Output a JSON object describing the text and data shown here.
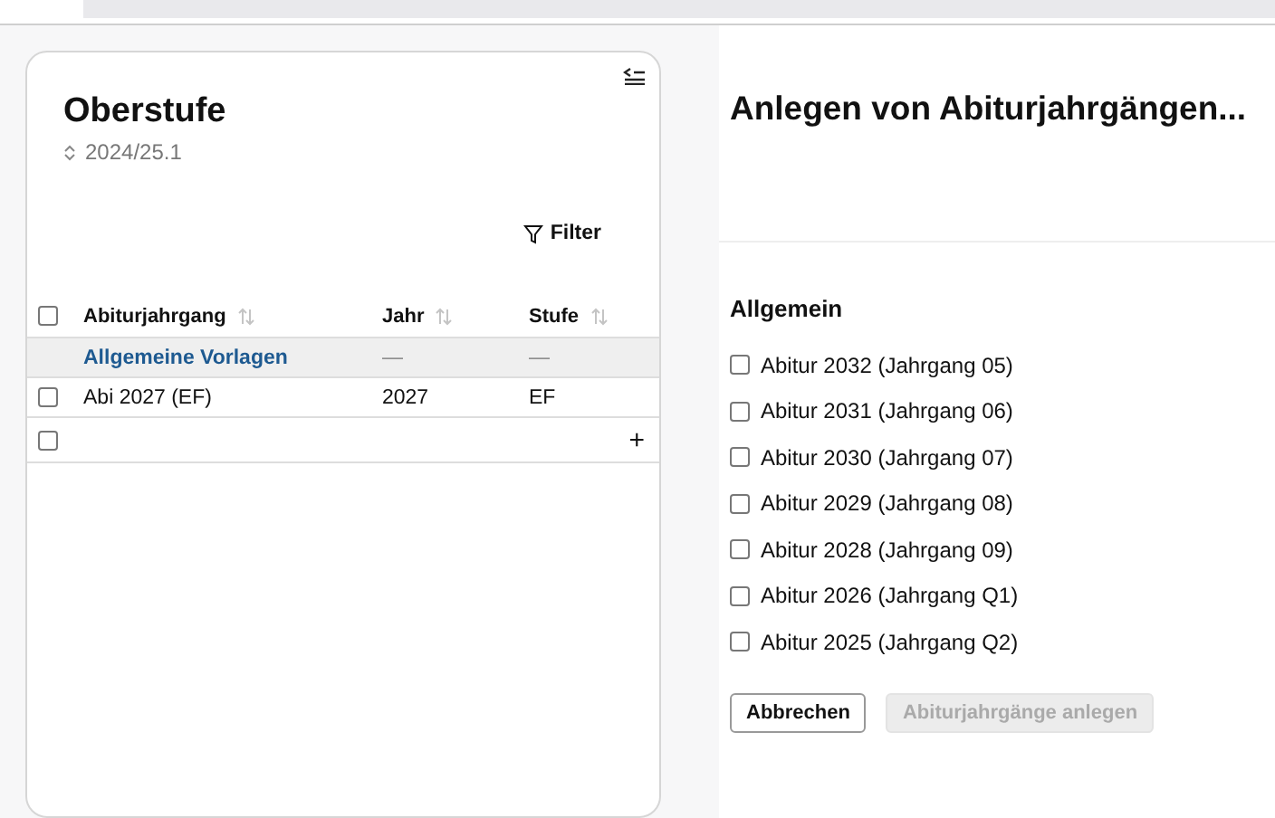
{
  "sidebar": {
    "title": "Oberstufe",
    "school_year": "2024/25.1",
    "filter_label": "Filter",
    "table": {
      "header_checked": false,
      "columns": [
        "Abiturjahrgang",
        "Jahr",
        "Stufe"
      ],
      "rows": [
        {
          "kind": "group",
          "cells": [
            "Allgemeine Vorlagen",
            "—",
            "—"
          ]
        },
        {
          "kind": "item",
          "checked": false,
          "cells": [
            "Abi 2027 (EF)",
            "2027",
            "EF"
          ]
        },
        {
          "kind": "add",
          "checked": false,
          "add_label": "+"
        }
      ]
    }
  },
  "dialog": {
    "title": "Anlegen von Abiturjahrgängen...",
    "section": "Allgemein",
    "options": [
      {
        "label": "Abitur 2032 (Jahrgang 05)",
        "checked": false
      },
      {
        "label": "Abitur 2031 (Jahrgang 06)",
        "checked": false
      },
      {
        "label": "Abitur 2030 (Jahrgang 07)",
        "checked": false
      },
      {
        "label": "Abitur 2029 (Jahrgang 08)",
        "checked": false
      },
      {
        "label": "Abitur 2028 (Jahrgang 09)",
        "checked": false
      },
      {
        "label": "Abitur 2026 (Jahrgang Q1)",
        "checked": false
      },
      {
        "label": "Abitur 2025 (Jahrgang Q2)",
        "checked": false
      }
    ],
    "buttons": [
      {
        "label": "Abbrechen",
        "disabled": false
      },
      {
        "label": "Abiturjahrgänge anlegen",
        "disabled": true
      }
    ]
  }
}
